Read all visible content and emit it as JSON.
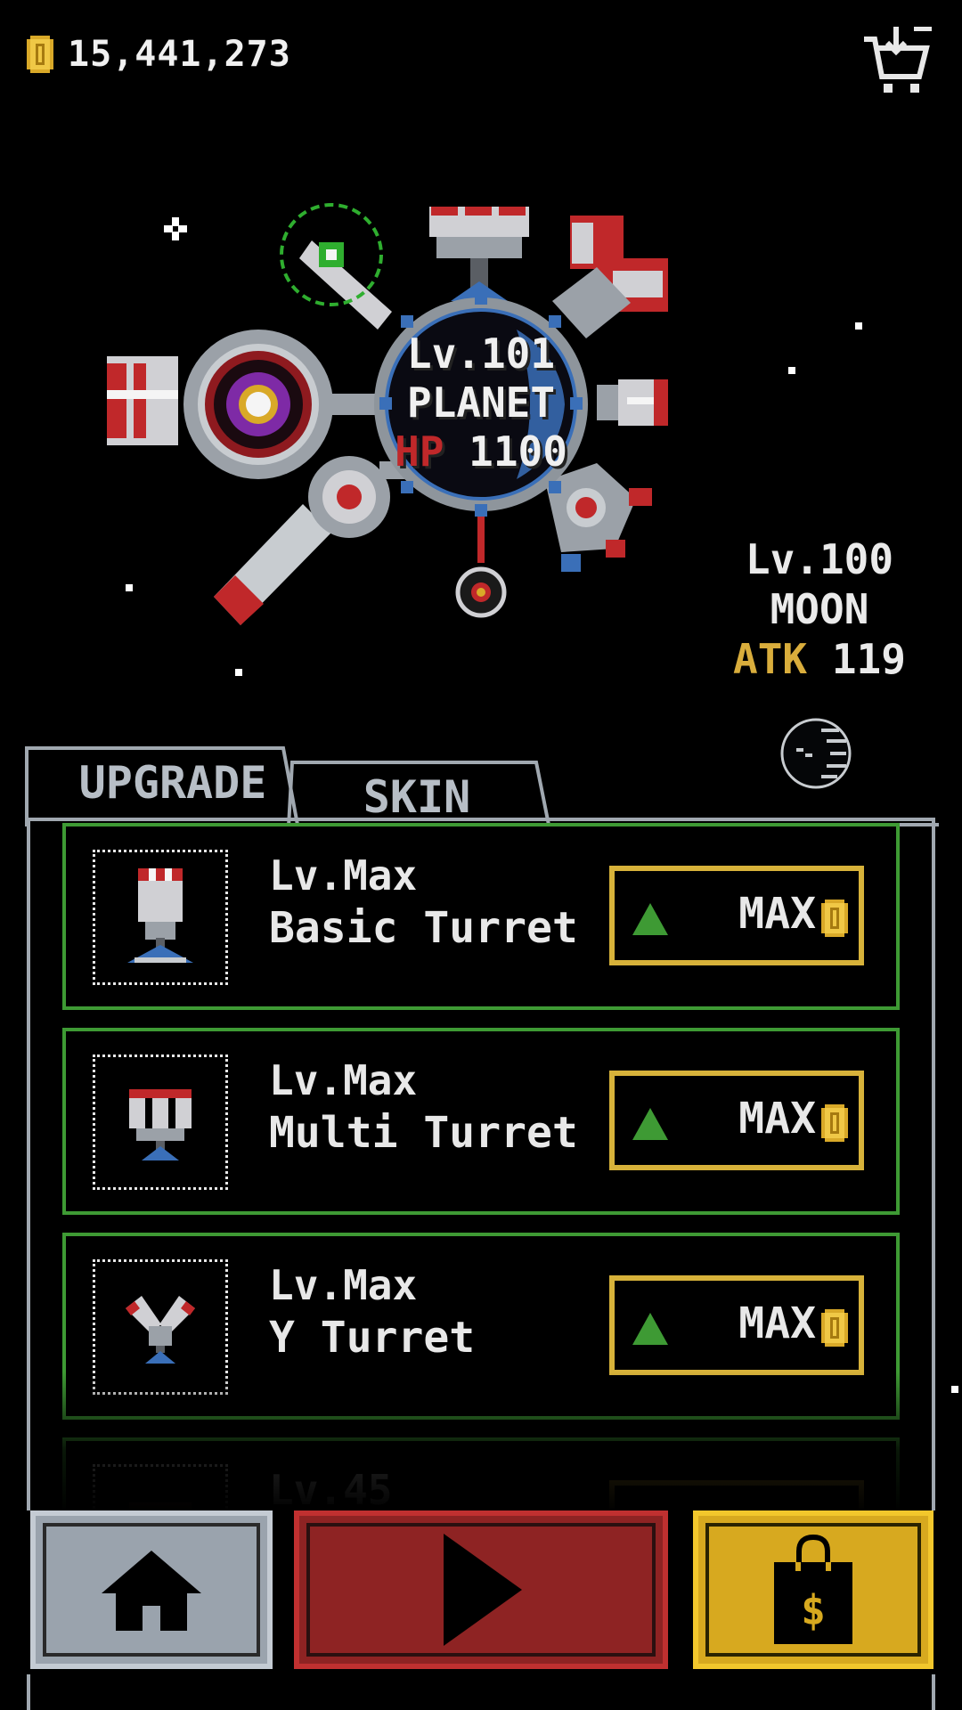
{
  "header": {
    "coins": "15,441,273",
    "coin_icon": "coin-icon",
    "cart_icon": "shopping-cart-icon"
  },
  "planet": {
    "level": "Lv.101",
    "name": "PLANET",
    "hp_label": "HP",
    "hp_value": "1100"
  },
  "moon": {
    "level": "Lv.100",
    "name": "MOON",
    "atk_label": "ATK",
    "atk_value": "119"
  },
  "tabs": [
    {
      "label": "UPGRADE",
      "active": true
    },
    {
      "label": "SKIN",
      "active": false
    }
  ],
  "upgrades": [
    {
      "level": "Lv.Max",
      "name": "Basic Turret",
      "button": "MAX",
      "icon": "basic-turret-icon"
    },
    {
      "level": "Lv.Max",
      "name": "Multi Turret",
      "button": "MAX",
      "icon": "multi-turret-icon"
    },
    {
      "level": "Lv.Max",
      "name": "Y Turret",
      "button": "MAX",
      "icon": "y-turret-icon"
    },
    {
      "level": "Lv.45",
      "name": "",
      "button": "",
      "icon": "turret-icon"
    }
  ],
  "bottom_nav": {
    "home_icon": "home-icon",
    "play_icon": "play-icon",
    "shop_icon": "shopping-bag-icon",
    "shop_symbol": "$"
  },
  "colors": {
    "background": "#000000",
    "card_border": "#3e9a34",
    "max_button_border": "#d7b23a",
    "hp_red": "#c0282a",
    "atk_gold": "#d9ad3c",
    "planet_blue": "#3a6fb8",
    "home_button": "#9aa3ad",
    "play_button": "#8e2323",
    "shop_button": "#d7a91f"
  }
}
